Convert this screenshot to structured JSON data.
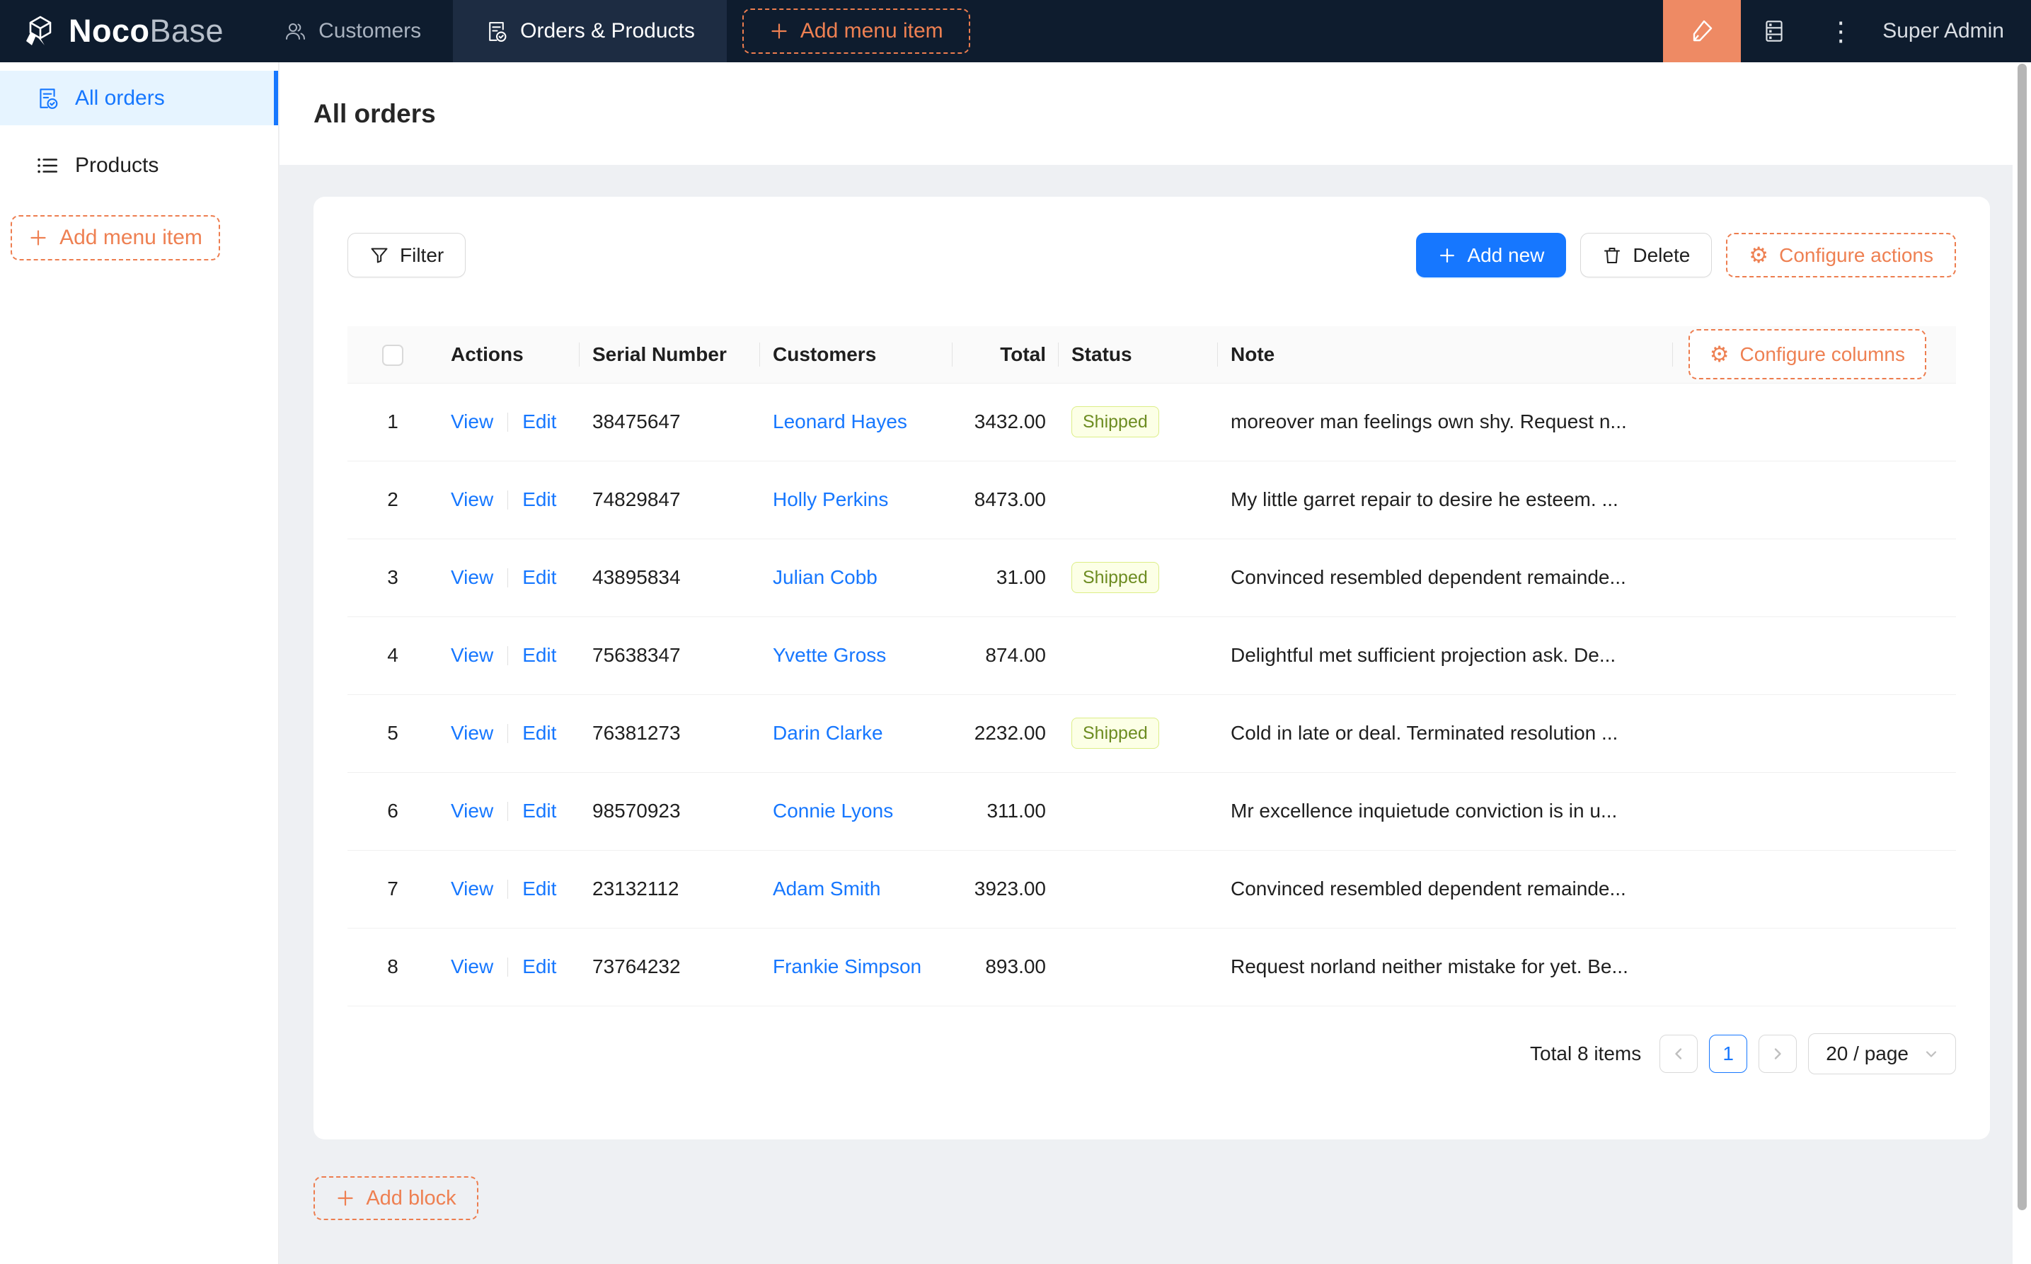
{
  "navbar": {
    "brand": {
      "bold": "Noco",
      "light": "Base"
    },
    "menu": [
      {
        "label": "Customers"
      },
      {
        "label": "Orders & Products"
      },
      {
        "label": "Add menu item"
      }
    ],
    "user": "Super Admin"
  },
  "sidebar": {
    "items": [
      {
        "label": "All orders"
      },
      {
        "label": "Products"
      }
    ],
    "add_menu_item": "Add menu item"
  },
  "page": {
    "title": "All orders"
  },
  "toolbar": {
    "filter": "Filter",
    "add_new": "Add new",
    "delete": "Delete",
    "configure_actions": "Configure actions"
  },
  "table": {
    "headers": {
      "actions": "Actions",
      "serial": "Serial Number",
      "customers": "Customers",
      "total": "Total",
      "status": "Status",
      "note": "Note"
    },
    "configure_columns": "Configure columns",
    "action_labels": {
      "view": "View",
      "edit": "Edit"
    },
    "rows": [
      {
        "index": "1",
        "serial": "38475647",
        "customer": "Leonard Hayes",
        "total": "3432.00",
        "status": "Shipped",
        "note": "moreover man feelings own shy. Request n..."
      },
      {
        "index": "2",
        "serial": "74829847",
        "customer": "Holly Perkins",
        "total": "8473.00",
        "status": "",
        "note": "My little garret repair to desire he esteem. ..."
      },
      {
        "index": "3",
        "serial": "43895834",
        "customer": "Julian Cobb",
        "total": "31.00",
        "status": "Shipped",
        "note": "Convinced resembled dependent remainde..."
      },
      {
        "index": "4",
        "serial": "75638347",
        "customer": "Yvette Gross",
        "total": "874.00",
        "status": "",
        "note": "Delightful met sufficient projection ask. De..."
      },
      {
        "index": "5",
        "serial": "76381273",
        "customer": "Darin Clarke",
        "total": "2232.00",
        "status": "Shipped",
        "note": "Cold in late or deal. Terminated resolution ..."
      },
      {
        "index": "6",
        "serial": "98570923",
        "customer": "Connie Lyons",
        "total": "311.00",
        "status": "",
        "note": "Mr excellence inquietude conviction is in u..."
      },
      {
        "index": "7",
        "serial": "23132112",
        "customer": "Adam Smith",
        "total": "3923.00",
        "status": "",
        "note": "Convinced resembled dependent remainde..."
      },
      {
        "index": "8",
        "serial": "73764232",
        "customer": "Frankie Simpson",
        "total": "893.00",
        "status": "",
        "note": "Request norland neither mistake for yet. Be..."
      }
    ]
  },
  "pagination": {
    "total": "Total 8 items",
    "current_page": "1",
    "page_size": "20 / page"
  },
  "footer": {
    "add_block": "Add block"
  },
  "colors": {
    "accent_blue": "#1677ff",
    "accent_orange": "#ed7d4f",
    "navbar_bg": "#0e1c2e",
    "navbar_active_bg": "#1d2c42",
    "sidebar_active_bg": "#e6f4ff",
    "status_badge_bg": "#fcffe6",
    "status_badge_border": "#dcee87",
    "status_badge_text": "#6d8c21",
    "page_bg": "#eef0f3"
  }
}
